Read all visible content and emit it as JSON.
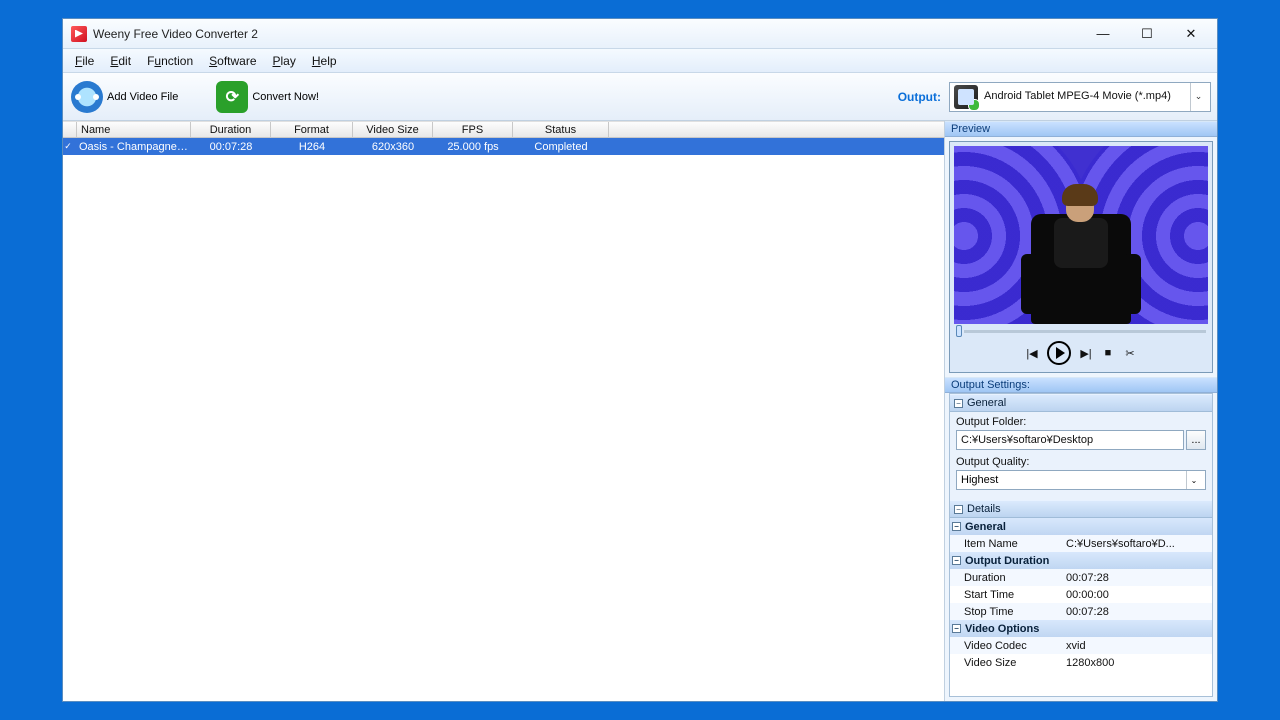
{
  "title": "Weeny Free Video Converter 2",
  "menu": [
    "File",
    "Edit",
    "Function",
    "Software",
    "Play",
    "Help"
  ],
  "toolbar": {
    "add_label": "Add Video File",
    "convert_label": "Convert Now!",
    "output_label": "Output:",
    "output_profile": "Android Tablet MPEG-4 Movie (*.mp4)"
  },
  "grid": {
    "headers": [
      "Name",
      "Duration",
      "Format",
      "Video Size",
      "FPS",
      "Status"
    ],
    "widths": [
      128,
      80,
      82,
      80,
      80,
      96
    ],
    "row": {
      "name": "Oasis - Champagne…",
      "duration": "00:07:28",
      "format": "H264",
      "size": "620x360",
      "fps": "25.000 fps",
      "status": "Completed"
    }
  },
  "sidebar": {
    "preview_title": "Preview",
    "settings_title": "Output Settings:",
    "general_title": "General",
    "folder_label": "Output Folder:",
    "folder_value": "C:¥Users¥softaro¥Desktop",
    "browse": "...",
    "quality_label": "Output Quality:",
    "quality_value": "Highest",
    "details_title": "Details",
    "details": {
      "general_label": "General",
      "item_name_key": "Item Name",
      "item_name_val": "C:¥Users¥softaro¥D...",
      "out_dur_label": "Output Duration",
      "duration_key": "Duration",
      "duration_val": "00:07:28",
      "start_key": "Start Time",
      "start_val": "00:00:00",
      "stop_key": "Stop Time",
      "stop_val": "00:07:28",
      "vopt_label": "Video Options",
      "vcodec_key": "Video Codec",
      "vcodec_val": "xvid",
      "vsize_key": "Video Size",
      "vsize_val": "1280x800"
    }
  }
}
